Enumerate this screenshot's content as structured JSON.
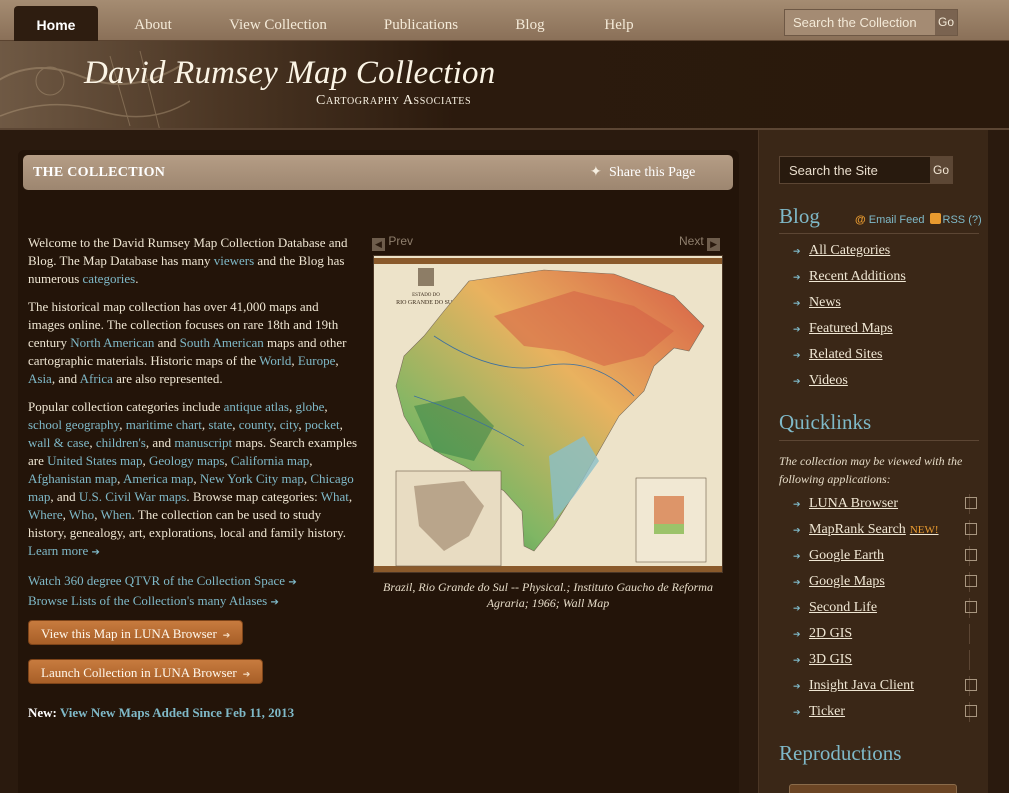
{
  "nav": {
    "items": [
      "Home",
      "About",
      "View Collection",
      "Publications",
      "Blog",
      "Help"
    ],
    "search_placeholder": "Search the Collection",
    "search_go": "Go"
  },
  "banner": {
    "title": "David Rumsey Map Collection",
    "subtitle": "Cartography Associates"
  },
  "main": {
    "section_title": "THE COLLECTION",
    "share_label": "Share this Page",
    "intro": {
      "p1_a": "Welcome to the David Rumsey Map Collection Database and Blog. The Map Database has many ",
      "p1_link1": "viewers",
      "p1_b": " and the Blog has numerous ",
      "p1_link2": "categories",
      "p1_c": ".",
      "p2_a": "The historical map collection has over 41,000 maps and images online. The collection focuses on rare 18th and 19th century ",
      "p2_link1": "North American",
      "p2_b": " and ",
      "p2_link2": "South American",
      "p2_c": " maps and other cartographic materials. Historic maps of the ",
      "p2_link3": "World",
      "p2_d": ", ",
      "p2_link4": "Europe",
      "p2_e": ", ",
      "p2_link5": "Asia",
      "p2_f": ", and ",
      "p2_link6": "Africa",
      "p2_g": " are also represented.",
      "p3_a": "Popular collection categories include ",
      "p3_links1": [
        "antique atlas",
        "globe",
        "school geography",
        "maritime chart",
        "state",
        "county",
        "city",
        "pocket",
        "wall & case",
        "children's"
      ],
      "p3_b": ", and ",
      "p3_link_manuscript": "manuscript",
      "p3_c": " maps. Search examples are ",
      "p3_links2": [
        "United States map",
        "Geology maps",
        "California map",
        "Afghanistan map",
        "America map",
        "New York City map",
        "Chicago map"
      ],
      "p3_d": ", and ",
      "p3_link_civil": "U.S. Civil War maps",
      "p3_e": ". Browse  map categories: ",
      "p3_links3": [
        "What",
        "Where",
        "Who",
        "When"
      ],
      "p3_f": ". The collection can be used to study history, genealogy, art, explorations, local and family history. ",
      "p3_learn": "Learn more",
      "watch": "Watch 360 degree QTVR of the Collection Space",
      "browse": "Browse Lists of the Collection's many Atlases"
    },
    "btn_view": "View this Map in LUNA Browser",
    "btn_launch": "Launch Collection in LUNA Browser",
    "new_label": "New:",
    "new_link": "View New Maps Added Since Feb 11, 2013",
    "viewer": {
      "prev": "Prev",
      "next": "Next",
      "caption": "Brazil, Rio Grande do Sul -- Physical.; Instituto Gaucho de Reforma Agraria; 1966; Wall Map",
      "map_title_line1": "ESTADO DO",
      "map_title_line2": "RIO GRANDE DO SUL"
    }
  },
  "sidebar": {
    "search_placeholder": "Search the Site",
    "search_go": "Go",
    "blog_heading": "Blog",
    "email_feed": "Email Feed",
    "rss": "RSS",
    "rss_help": "(?)",
    "blog_items": [
      "All Categories",
      "Recent Additions",
      "News",
      "Featured Maps",
      "Related Sites",
      "Videos"
    ],
    "quick_heading": "Quicklinks",
    "quick_note": "The collection may be viewed with the following applications:",
    "quick_items": [
      {
        "label": "LUNA Browser",
        "ext": true
      },
      {
        "label": "MapRank Search",
        "badge": "NEW!",
        "ext": true
      },
      {
        "label": "Google Earth",
        "ext": true
      },
      {
        "label": "Google Maps",
        "ext": true
      },
      {
        "label": "Second Life",
        "ext": true
      },
      {
        "label": "2D GIS",
        "ext": false
      },
      {
        "label": "3D GIS",
        "ext": false
      },
      {
        "label": "Insight Java Client",
        "ext": true
      },
      {
        "label": "Ticker",
        "ext": true
      }
    ],
    "repro_heading": "Reproductions"
  }
}
